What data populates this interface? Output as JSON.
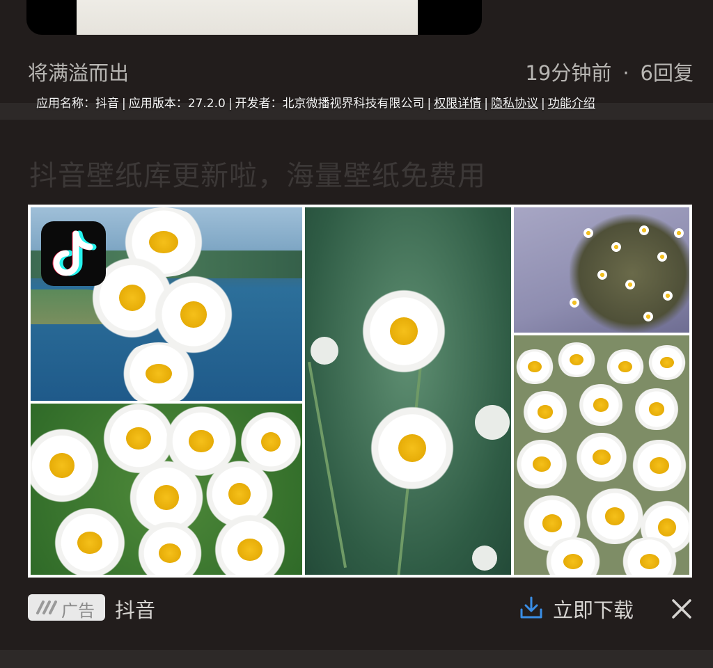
{
  "post": {
    "title": "将满溢而出",
    "time": "19分钟前",
    "separator": "·",
    "replies": "6回复"
  },
  "ad": {
    "headline": "抖音壁纸库更新啦，海量壁纸免费用",
    "info": {
      "app_name_label": "应用名称：",
      "app_name": "抖音",
      "version_label": "应用版本：",
      "version": "27.2.0",
      "developer_label": "开发者：",
      "developer": "北京微播视界科技有限公司",
      "permissions": "权限详情",
      "privacy": "隐私协议",
      "features": "功能介绍",
      "sep": "|"
    },
    "logo_icon": "tiktok-logo-icon",
    "badge_label": "广告",
    "badge_icon": "ad-mark-icon",
    "advertiser": "抖音",
    "download_label": "立即下载",
    "download_icon": "download-icon",
    "close_icon": "close-icon",
    "colors": {
      "accent": "#3a8ee6",
      "background": "#221d1c",
      "divider": "#2d2928",
      "headline_text": "#3c3837"
    }
  }
}
